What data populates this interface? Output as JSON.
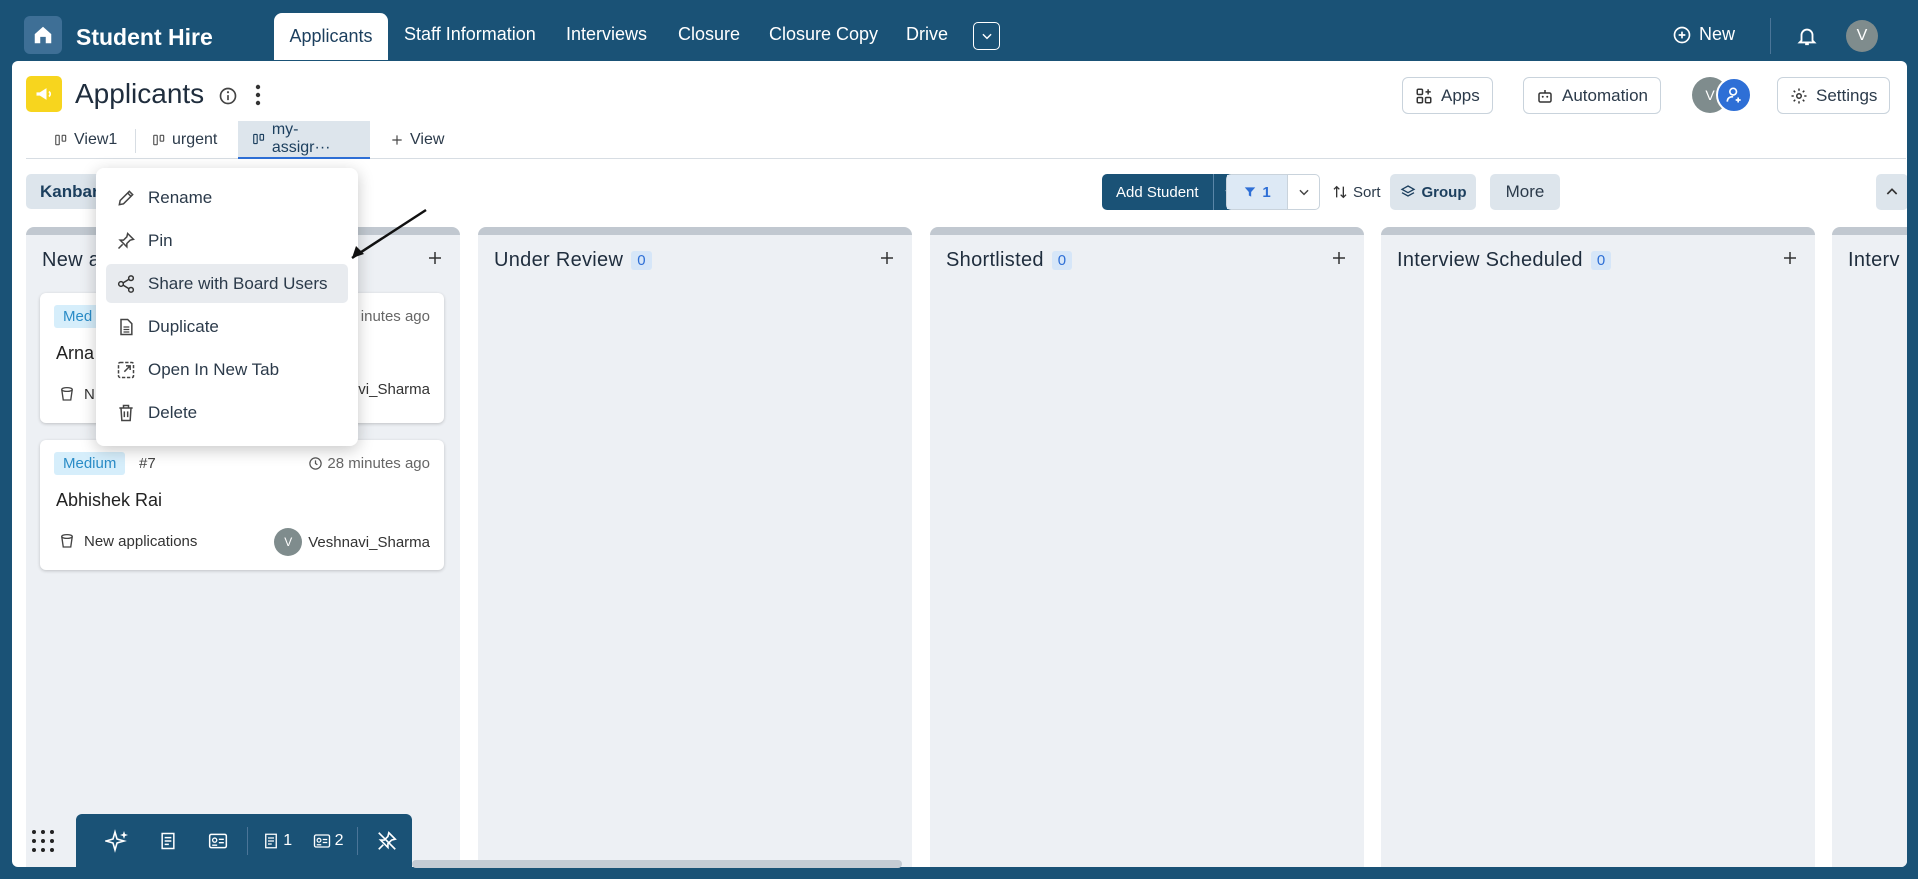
{
  "app": {
    "name": "Student Hire"
  },
  "nav": {
    "tabs": [
      "Applicants",
      "Staff Information",
      "Interviews",
      "Closure",
      "Closure Copy",
      "Drive"
    ],
    "new_label": "New",
    "user_initial": "V"
  },
  "board": {
    "title": "Applicants",
    "apps_label": "Apps",
    "automation_label": "Automation",
    "settings_label": "Settings",
    "member_initial": "V"
  },
  "views": {
    "items": [
      "View1",
      "urgent",
      "my-assigr···"
    ],
    "add_label": "View"
  },
  "toolbar": {
    "layout_label": "Kanban",
    "add_student_label": "Add Student",
    "filter_count": "1",
    "sort_label": "Sort",
    "group_label": "Group",
    "more_label": "More"
  },
  "columns": [
    {
      "title": "New a",
      "count": ""
    },
    {
      "title": "Under Review",
      "count": "0"
    },
    {
      "title": "Shortlisted",
      "count": "0"
    },
    {
      "title": "Interview Scheduled",
      "count": "0"
    },
    {
      "title": "Interv",
      "count": ""
    }
  ],
  "cards": [
    {
      "priority": "Med",
      "number": "",
      "time": "inutes ago",
      "name": "Arna",
      "stage": "N",
      "user": "vi_Sharma",
      "user_initial": ""
    },
    {
      "priority": "Medium",
      "number": "#7",
      "time": "28 minutes ago",
      "name": "Abhishek Rai",
      "stage": "New applications",
      "user": "Veshnavi_Sharma",
      "user_initial": "V"
    }
  ],
  "context_menu": {
    "items": [
      "Rename",
      "Pin",
      "Share with Board Users",
      "Duplicate",
      "Open In New Tab",
      "Delete"
    ],
    "hovered": "Share with Board Users"
  },
  "dock": {
    "notes_count": "1",
    "cards_count": "2"
  },
  "colors": {
    "primary": "#1a5276",
    "accent": "#2e6fd6",
    "board_icon": "#f7d51e"
  }
}
